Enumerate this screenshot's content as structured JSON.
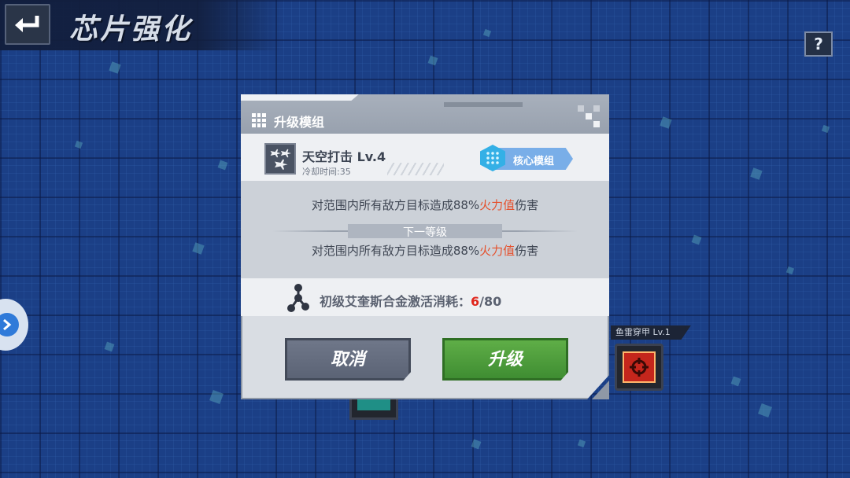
{
  "header": {
    "title": "芯片强化",
    "help_label": "?"
  },
  "background": {
    "module_label": "鱼雷穿甲 Lv.1"
  },
  "dialog": {
    "title": "升级模组",
    "skill": {
      "name": "天空打击 Lv.4",
      "cooldown": "冷却时间:35",
      "icon": "jets-icon"
    },
    "badge": {
      "label": "核心模组",
      "color": "#79aee8"
    },
    "description": {
      "current_prefix": "对范围内所有敌方目标造成88%",
      "current_highlight": "火力值",
      "current_suffix": "伤害",
      "next_level_label": "下一等级",
      "next_prefix": "对范围内所有敌方目标造成88%",
      "next_highlight": "火力值",
      "next_suffix": "伤害",
      "highlight_color": "#e5502c"
    },
    "cost": {
      "label": "初级艾奎斯合金激活消耗：",
      "current": "6",
      "separator": "/",
      "required": "80"
    },
    "buttons": {
      "cancel": "取消",
      "upgrade": "升级"
    }
  }
}
